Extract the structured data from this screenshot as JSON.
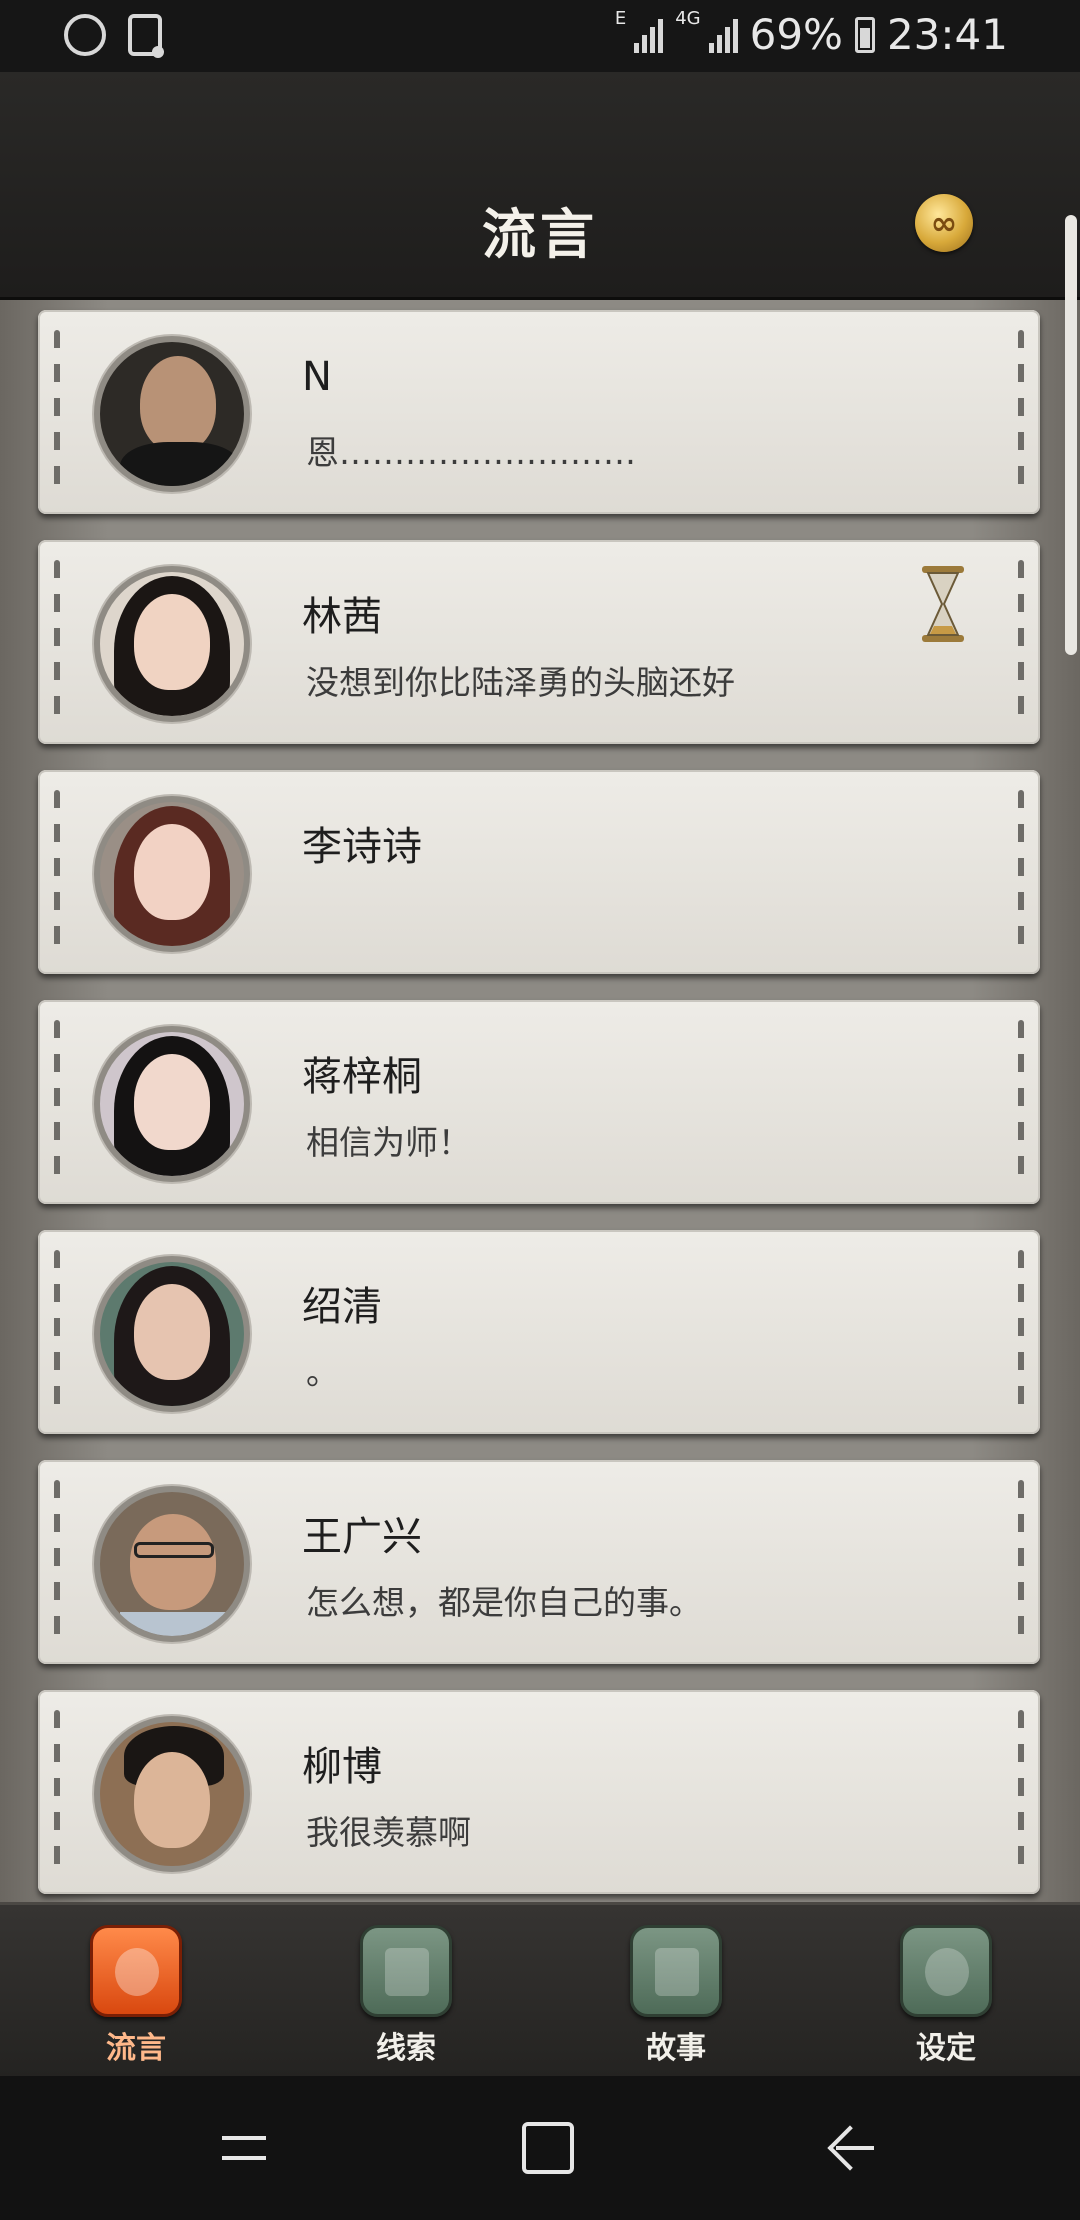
{
  "status_bar": {
    "network_label": "E",
    "network_type": "4G",
    "battery": "69%",
    "time": "23:41"
  },
  "header": {
    "title": "流言",
    "coin_symbol": "∞"
  },
  "contacts": [
    {
      "name": "N",
      "message": "恩………………………"
    },
    {
      "name": "林茜",
      "message": "没想到你比陆泽勇的头脑还好",
      "pending": true
    },
    {
      "name": "李诗诗",
      "message": ""
    },
    {
      "name": "蒋梓桐",
      "message": "相信为师！"
    },
    {
      "name": "绍清",
      "message": "。"
    },
    {
      "name": "王广兴",
      "message": "怎么想，都是你自己的事。"
    },
    {
      "name": "柳博",
      "message": "我很羡慕啊"
    }
  ],
  "tabs": [
    {
      "label": "流言",
      "icon": "chat-bubble-icon",
      "active": true
    },
    {
      "label": "线索",
      "icon": "document-icon",
      "active": false
    },
    {
      "label": "故事",
      "icon": "book-icon",
      "active": false
    },
    {
      "label": "设定",
      "icon": "gear-icon",
      "active": false
    }
  ],
  "colors": {
    "accent": "#e8531c",
    "card": "#e6e4de",
    "tab_icon": "#5f7e69"
  }
}
